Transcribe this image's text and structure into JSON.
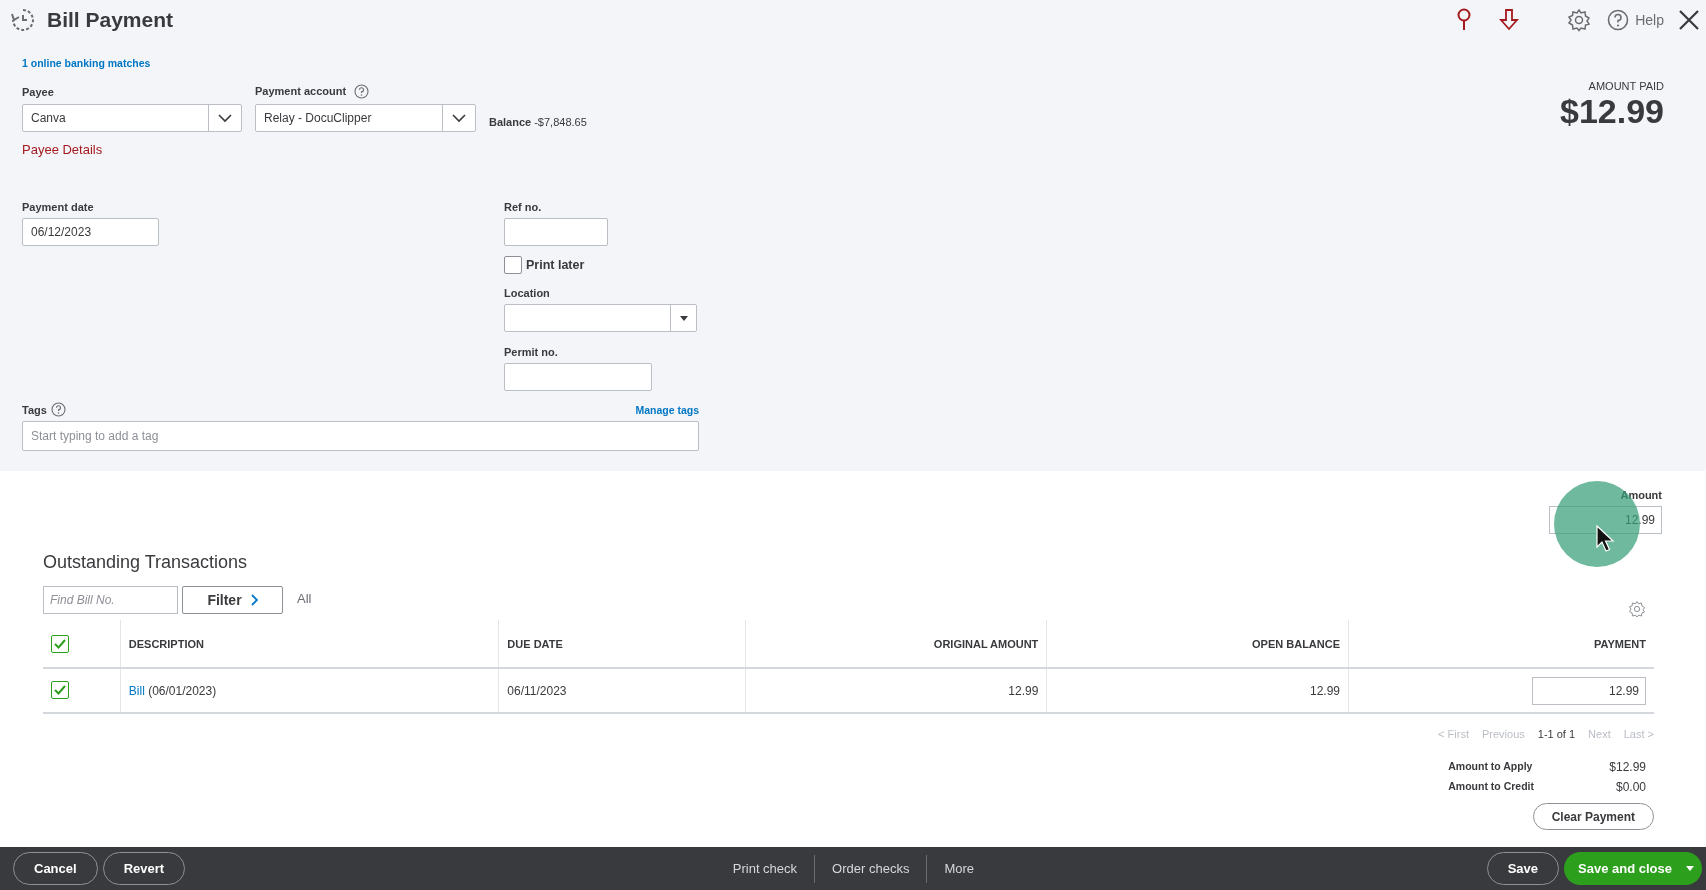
{
  "header": {
    "title": "Bill Payment",
    "help": "Help"
  },
  "form": {
    "banking_link": "1 online banking matches",
    "payee": {
      "label": "Payee",
      "value": "Canva"
    },
    "payee_details": "Payee Details",
    "payment_account": {
      "label": "Payment account",
      "value": "Relay - DocuClipper"
    },
    "balance": {
      "label": "Balance",
      "value": "-$7,848.65"
    },
    "amount_paid": {
      "label": "AMOUNT PAID",
      "value": "$12.99"
    },
    "payment_date": {
      "label": "Payment date",
      "value": "06/12/2023"
    },
    "ref_no": {
      "label": "Ref no."
    },
    "print_later": {
      "label": "Print later",
      "checked": false
    },
    "location": {
      "label": "Location"
    },
    "permit_no": {
      "label": "Permit no."
    },
    "tags": {
      "label": "Tags",
      "manage": "Manage tags",
      "placeholder": "Start typing to add a tag"
    }
  },
  "amount": {
    "label": "Amount",
    "value": "12.99"
  },
  "transactions": {
    "title": "Outstanding Transactions",
    "search_placeholder": "Find Bill No.",
    "filter": "Filter",
    "filter_value": "All",
    "select_all": true,
    "columns": [
      "DESCRIPTION",
      "DUE DATE",
      "ORIGINAL AMOUNT",
      "OPEN BALANCE",
      "PAYMENT"
    ],
    "rows": [
      {
        "checked": true,
        "link": "Bill",
        "description": "(06/01/2023)",
        "due_date": "06/11/2023",
        "original_amount": "12.99",
        "open_balance": "12.99",
        "payment": "12.99"
      }
    ],
    "pagination": [
      {
        "label": "< First",
        "disabled": true
      },
      {
        "label": "Previous",
        "disabled": true
      },
      {
        "label": "1-1 of 1",
        "disabled": false
      },
      {
        "label": "Next",
        "disabled": true
      },
      {
        "label": "Last >",
        "disabled": true
      }
    ],
    "summary": [
      {
        "label": "Amount to Apply",
        "value": "$12.99"
      },
      {
        "label": "Amount to Credit",
        "value": "$0.00"
      }
    ],
    "clear": "Clear Payment"
  },
  "footer": {
    "left": [
      "Cancel",
      "Revert"
    ],
    "center": [
      "Print check",
      "Order checks",
      "More"
    ],
    "save": "Save",
    "save_close": "Save and close"
  }
}
